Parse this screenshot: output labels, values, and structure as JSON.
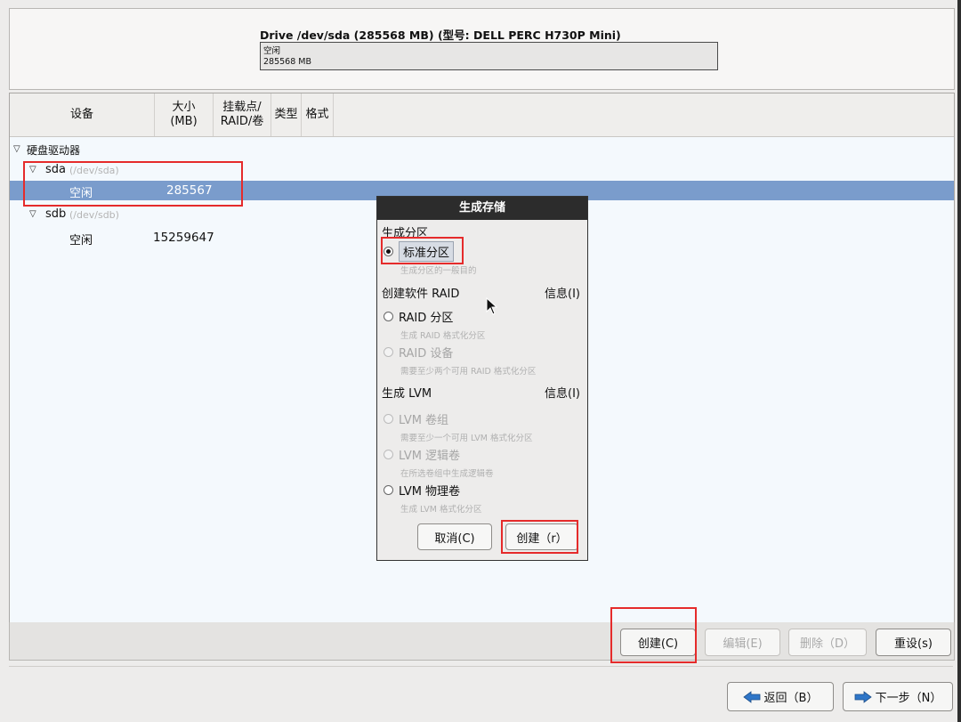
{
  "drive": {
    "title": "Drive /dev/sda (285568 MB) (型号: DELL PERC H730P Mini)",
    "bar_line1": "空闲",
    "bar_line2": "285568 MB"
  },
  "table": {
    "headers": {
      "device": "设备",
      "size": "大小\n(MB)",
      "mount": "挂载点/\nRAID/卷",
      "type": "类型",
      "format": "格式"
    },
    "group": "硬盘驱动器",
    "sda": {
      "name": "sda",
      "path": "(/dev/sda)",
      "free_label": "空闲",
      "free_size": "285567"
    },
    "sdb": {
      "name": "sdb",
      "path": "(/dev/sdb)",
      "free_label": "空闲",
      "free_size": "15259647"
    }
  },
  "dialog": {
    "title": "生成存储",
    "section_partition": "生成分区",
    "opt_standard": "标准分区",
    "opt_standard_desc": "生成分区的一般目的",
    "section_raid": "创建软件 RAID",
    "raid_info": "信息(I)",
    "opt_raid_part": "RAID 分区",
    "opt_raid_part_desc": "生成 RAID 格式化分区",
    "opt_raid_dev": "RAID 设备",
    "opt_raid_dev_desc": "需要至少两个可用 RAID 格式化分区",
    "section_lvm": "生成 LVM",
    "lvm_info": "信息(I)",
    "opt_lvm_vg": "LVM 卷组",
    "opt_lvm_vg_desc": "需要至少一个可用 LVM 格式化分区",
    "opt_lvm_lv": "LVM 逻辑卷",
    "opt_lvm_lv_desc": "在所选卷组中生成逻辑卷",
    "opt_lvm_pv": "LVM 物理卷",
    "opt_lvm_pv_desc": "生成 LVM 格式化分区",
    "cancel": "取消(C)",
    "create": "创建（r）"
  },
  "actions": {
    "create": "创建(C)",
    "edit": "编辑(E)",
    "delete": "删除（D）",
    "reset": "重设(s)"
  },
  "nav": {
    "back": "返回（B）",
    "next": "下一步（N）"
  }
}
